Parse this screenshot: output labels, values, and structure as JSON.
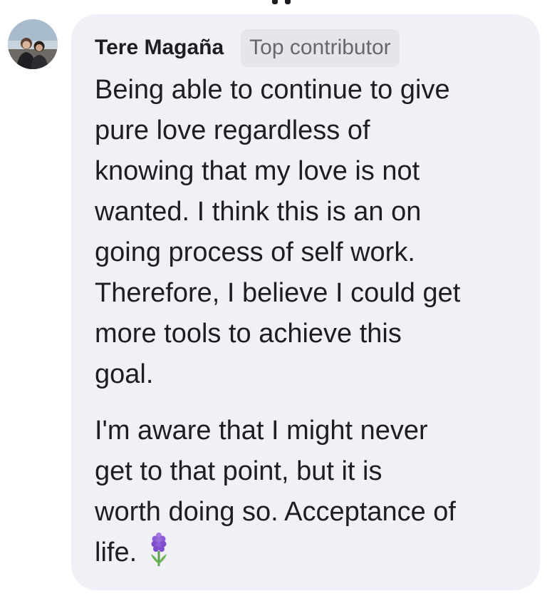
{
  "comment": {
    "author": "Tere Magaña",
    "badge": "Top contributor",
    "paragraphs": [
      "Being able to continue to give\npure love regardless of\nknowing that my love is not\nwanted. I think this is an on\ngoing process of self work.\nTherefore, I believe I could get\nmore tools to achieve this\ngoal.",
      "I'm aware that I might never\nget to that point, but it is\nworth doing so. Acceptance of\nlife."
    ],
    "emoji": "hyacinth-icon",
    "colors": {
      "bubble": "#f0f1f6",
      "text": "#1c1e21",
      "badge_bg": "#e4e6eb",
      "badge_text": "#65676b",
      "emoji": "#8e5bd6"
    }
  }
}
